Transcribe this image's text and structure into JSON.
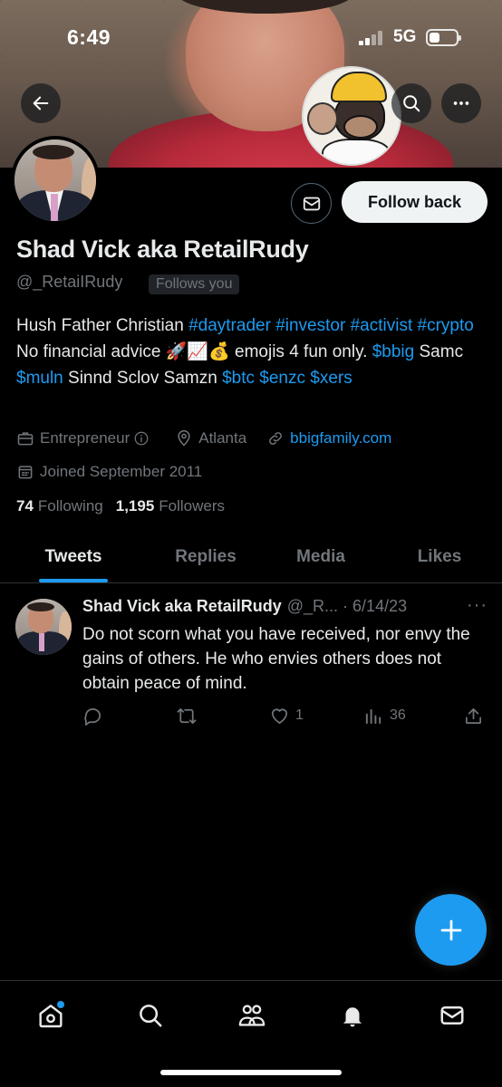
{
  "status_bar": {
    "time": "6:49",
    "network": "5G",
    "battery_level": 0.35
  },
  "header": {
    "back_icon": "arrow-left-icon",
    "search_icon": "search-icon",
    "more_icon": "more-horizontal-icon"
  },
  "profile": {
    "name": "Shad Vick aka RetailRudy",
    "handle": "@_RetaiIRudy",
    "follows_you": "Follows you",
    "follow_back_label": "Follow back",
    "bio": [
      {
        "text": "Hush Father Christian ",
        "link": false
      },
      {
        "text": "#daytrader",
        "link": true
      },
      {
        "text": " ",
        "link": false
      },
      {
        "text": "#investor",
        "link": true
      },
      {
        "text": " ",
        "link": false
      },
      {
        "text": "#activist",
        "link": true
      },
      {
        "text": " ",
        "link": false
      },
      {
        "text": "#crypto",
        "link": true
      },
      {
        "text": " No financial advice 🚀📈💰 emojis 4 fun only. ",
        "link": false
      },
      {
        "text": "$bbig",
        "link": true
      },
      {
        "text": " Samc ",
        "link": false
      },
      {
        "text": "$muln",
        "link": true
      },
      {
        "text": " Sinnd Sclov Samzn ",
        "link": false
      },
      {
        "text": "$btc",
        "link": true
      },
      {
        "text": " ",
        "link": false
      },
      {
        "text": "$enzc",
        "link": true
      },
      {
        "text": " ",
        "link": false
      },
      {
        "text": "$xers",
        "link": true
      }
    ],
    "category": "Entrepreneur",
    "location": "Atlanta",
    "website": "bbigfamily.com",
    "joined": "Joined September 2011",
    "following_count": "74",
    "following_label": "Following",
    "followers_count": "1,195",
    "followers_label": "Followers"
  },
  "tabs": [
    "Tweets",
    "Replies",
    "Media",
    "Likes"
  ],
  "active_tab": 0,
  "tweet": {
    "name": "Shad Vick aka RetailRudy",
    "handle_date": "@_R... · 6/14/23",
    "text": "Do not scorn what you have received, nor envy the gains of others. He who envies others does not obtain peace of mind.",
    "likes": "1",
    "views": "36"
  },
  "colors": {
    "accent": "#1d9bf0",
    "background": "#000000",
    "muted": "#71767b"
  }
}
